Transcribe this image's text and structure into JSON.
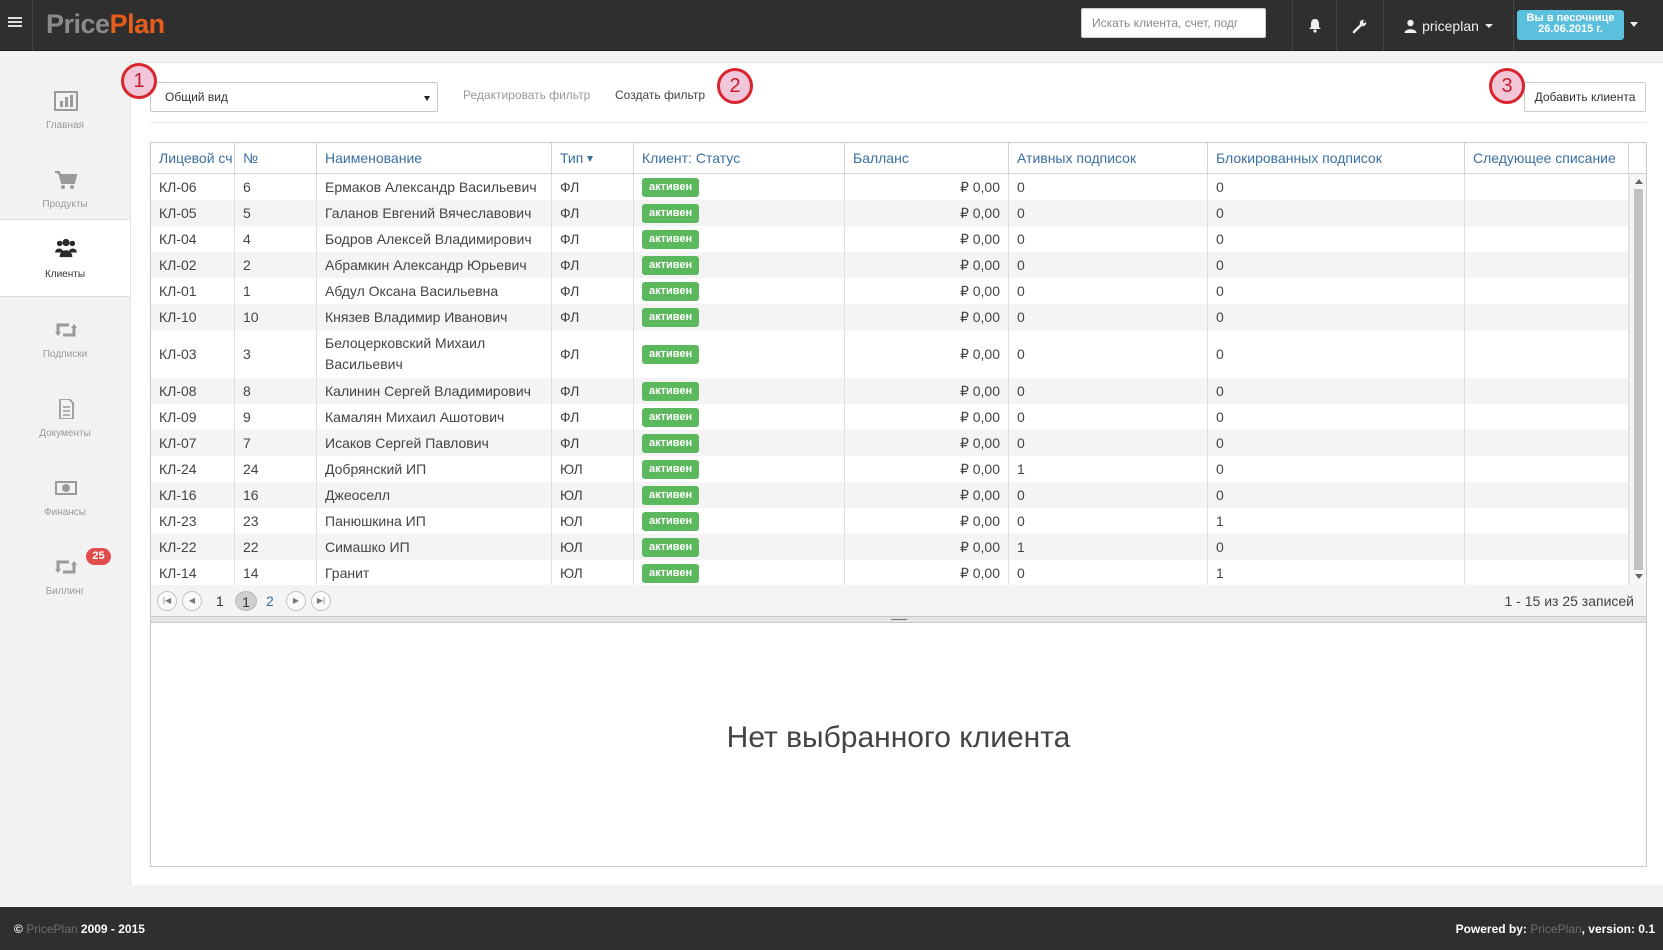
{
  "topbar": {
    "logo_part1": "Price",
    "logo_part2": "Plan",
    "search_placeholder": "Искать клиента, счет, подг",
    "user_name": "priceplan",
    "sandbox_line1": "Вы в песочнице",
    "sandbox_line2": "26.06.2015 г."
  },
  "sidebar": {
    "items": [
      {
        "label": "Главная",
        "icon": "bar-chart-icon"
      },
      {
        "label": "Продукты",
        "icon": "cart-icon"
      },
      {
        "label": "Клиенты",
        "icon": "users-icon"
      },
      {
        "label": "Подписки",
        "icon": "retweet-icon"
      },
      {
        "label": "Документы",
        "icon": "document-icon"
      },
      {
        "label": "Финансы",
        "icon": "money-icon"
      },
      {
        "label": "Биллинг",
        "icon": "retweet-icon"
      }
    ],
    "billing_badge": "25"
  },
  "toolbar": {
    "filter_selected": "Общий вид",
    "edit_filter": "Редактировать фильтр",
    "create_filter": "Создать фильтр",
    "add_client": "Добавить клиента"
  },
  "markers": [
    "1",
    "2",
    "3"
  ],
  "colors": {
    "accent": "#e85d1a",
    "badge_green": "#5cb85c",
    "header_link": "#3a6fa2",
    "sandbox": "#5bc0de",
    "notify": "#e04b4b"
  },
  "table": {
    "columns": [
      "Лицевой сч",
      "№",
      "Наименование",
      "Тип",
      "Клиент: Статус",
      "Балланс",
      "Ативных подписок",
      "Блокированных подписок",
      "Следующее списание"
    ],
    "rows": [
      {
        "account": "КЛ-06",
        "num": "6",
        "name": "Ермаков Александр Васильевич",
        "type": "ФЛ",
        "status": "активен",
        "balance": "₽ 0,00",
        "active": "0",
        "blocked": "0",
        "next": ""
      },
      {
        "account": "КЛ-05",
        "num": "5",
        "name": "Галанов Евгений Вячеславович",
        "type": "ФЛ",
        "status": "активен",
        "balance": "₽ 0,00",
        "active": "0",
        "blocked": "0",
        "next": ""
      },
      {
        "account": "КЛ-04",
        "num": "4",
        "name": "Бодров Алексей Владимирович",
        "type": "ФЛ",
        "status": "активен",
        "balance": "₽ 0,00",
        "active": "0",
        "blocked": "0",
        "next": ""
      },
      {
        "account": "КЛ-02",
        "num": "2",
        "name": "Абрамкин Александр Юрьевич",
        "type": "ФЛ",
        "status": "активен",
        "balance": "₽ 0,00",
        "active": "0",
        "blocked": "0",
        "next": ""
      },
      {
        "account": "КЛ-01",
        "num": "1",
        "name": "Абдул Оксана Васильевна",
        "type": "ФЛ",
        "status": "активен",
        "balance": "₽ 0,00",
        "active": "0",
        "blocked": "0",
        "next": ""
      },
      {
        "account": "КЛ-10",
        "num": "10",
        "name": "Князев Владимир Иванович",
        "type": "ФЛ",
        "status": "активен",
        "balance": "₽ 0,00",
        "active": "0",
        "blocked": "0",
        "next": ""
      },
      {
        "account": "КЛ-03",
        "num": "3",
        "name": "Белоцерковский Михаил Васильевич",
        "type": "ФЛ",
        "status": "активен",
        "balance": "₽ 0,00",
        "active": "0",
        "blocked": "0",
        "next": ""
      },
      {
        "account": "КЛ-08",
        "num": "8",
        "name": "Калинин Сергей Владимирович",
        "type": "ФЛ",
        "status": "активен",
        "balance": "₽ 0,00",
        "active": "0",
        "blocked": "0",
        "next": ""
      },
      {
        "account": "КЛ-09",
        "num": "9",
        "name": "Камалян Михаил Ашотович",
        "type": "ФЛ",
        "status": "активен",
        "balance": "₽ 0,00",
        "active": "0",
        "blocked": "0",
        "next": ""
      },
      {
        "account": "КЛ-07",
        "num": "7",
        "name": "Исаков Сергей Павлович",
        "type": "ФЛ",
        "status": "активен",
        "balance": "₽ 0,00",
        "active": "0",
        "blocked": "0",
        "next": ""
      },
      {
        "account": "КЛ-24",
        "num": "24",
        "name": "Добрянский ИП",
        "type": "ЮЛ",
        "status": "активен",
        "balance": "₽ 0,00",
        "active": "1",
        "blocked": "0",
        "next": ""
      },
      {
        "account": "КЛ-16",
        "num": "16",
        "name": "Джеоселл",
        "type": "ЮЛ",
        "status": "активен",
        "balance": "₽ 0,00",
        "active": "0",
        "blocked": "0",
        "next": ""
      },
      {
        "account": "КЛ-23",
        "num": "23",
        "name": "Панюшкина ИП",
        "type": "ЮЛ",
        "status": "активен",
        "balance": "₽ 0,00",
        "active": "0",
        "blocked": "1",
        "next": ""
      },
      {
        "account": "КЛ-22",
        "num": "22",
        "name": "Симашко ИП",
        "type": "ЮЛ",
        "status": "активен",
        "balance": "₽ 0,00",
        "active": "1",
        "blocked": "0",
        "next": ""
      },
      {
        "account": "КЛ-14",
        "num": "14",
        "name": "Гранит",
        "type": "ЮЛ",
        "status": "активен",
        "balance": "₽ 0,00",
        "active": "0",
        "blocked": "1",
        "next": ""
      }
    ]
  },
  "pager": {
    "page_first": "1",
    "page_current": "1",
    "page_next": "2",
    "info": "1 - 15 из 25 записей"
  },
  "detail": {
    "empty_text": "Нет выбранного клиента"
  },
  "footer": {
    "copyright": "©",
    "brand": "PricePlan",
    "years": "2009 - 2015",
    "powered_label": "Powered by:",
    "version_text": ", version: 0.1"
  }
}
